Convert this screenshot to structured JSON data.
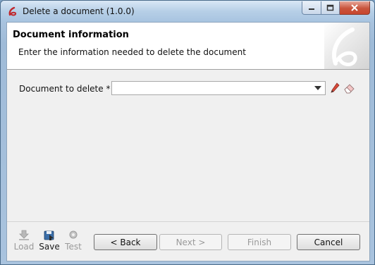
{
  "window": {
    "title": "Delete a document (1.0.0)"
  },
  "header": {
    "title": "Document information",
    "subtitle": "Enter the information needed to delete the document"
  },
  "form": {
    "document_label": "Document to delete *",
    "document_value": ""
  },
  "toolbar": {
    "load_label": "Load",
    "save_label": "Save",
    "test_label": "Test"
  },
  "buttons": {
    "back": "< Back",
    "next": "Next >",
    "finish": "Finish",
    "cancel": "Cancel"
  },
  "colors": {
    "accent": "#c0282d",
    "window_frame": "#a9c3de",
    "close_button": "#c7452d"
  }
}
